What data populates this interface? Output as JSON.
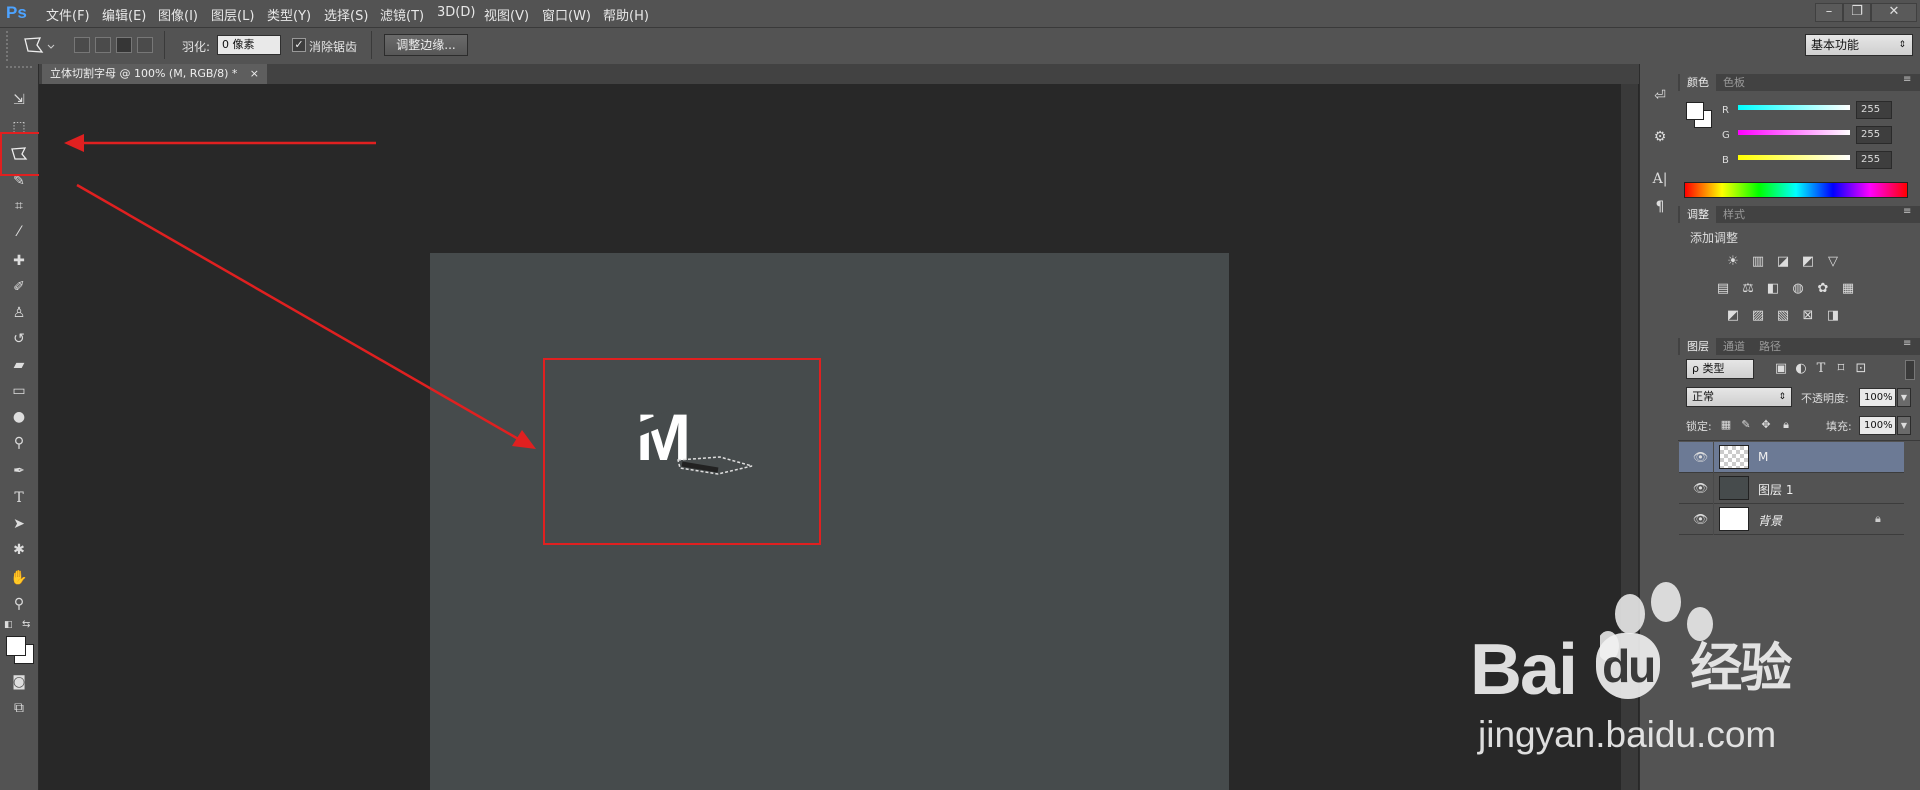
{
  "app": {
    "logo": "Ps"
  },
  "menu": [
    {
      "label": "文件(F)"
    },
    {
      "label": "编辑(E)"
    },
    {
      "label": "图像(I)"
    },
    {
      "label": "图层(L)"
    },
    {
      "label": "类型(Y)"
    },
    {
      "label": "选择(S)"
    },
    {
      "label": "滤镜(T)"
    },
    {
      "label": "3D(D)"
    },
    {
      "label": "视图(V)"
    },
    {
      "label": "窗口(W)"
    },
    {
      "label": "帮助(H)"
    }
  ],
  "window_controls": {
    "minimize": "–",
    "restore": "❐",
    "close": "✕"
  },
  "options": {
    "feather_label": "羽化:",
    "feather_value": "0 像素",
    "antialias_label": "消除锯齿",
    "antialias_checked": true,
    "refine_edge": "调整边缘...",
    "workspace": "基本功能"
  },
  "document": {
    "tab_title": "立体切割字母 @ 100% (M, RGB/8) *",
    "tab_close": "×",
    "letter": "M"
  },
  "panels": {
    "color": {
      "tabs": [
        "颜色",
        "色板"
      ],
      "channels": [
        {
          "name": "R",
          "value": "255",
          "color": "#00ffff"
        },
        {
          "name": "G",
          "value": "255",
          "color": "#ff00ff"
        },
        {
          "name": "B",
          "value": "255",
          "color": "#ffff00"
        }
      ]
    },
    "adjustments": {
      "tabs": [
        "调整",
        "样式"
      ],
      "title": "添加调整"
    },
    "layers": {
      "tabs": [
        "图层",
        "通道",
        "路径"
      ],
      "filter_kind": "ρ 类型",
      "blend_mode": "正常",
      "opacity_label": "不透明度:",
      "opacity_value": "100%",
      "lock_label": "锁定:",
      "fill_label": "填充:",
      "fill_value": "100%",
      "items": [
        {
          "name": "M",
          "selected": true
        },
        {
          "name": "图层 1",
          "selected": false
        },
        {
          "name": "背景",
          "selected": false,
          "locked": true
        }
      ]
    }
  },
  "watermark": {
    "brand_a": "Bai",
    "brand_b": "du",
    "brand_cn": "经验",
    "url": "jingyan.baidu.com"
  },
  "colors": {
    "accent_annotation": "#e02020",
    "selected_layer": "#6c7a95",
    "ps_blue": "#4da3ff"
  }
}
